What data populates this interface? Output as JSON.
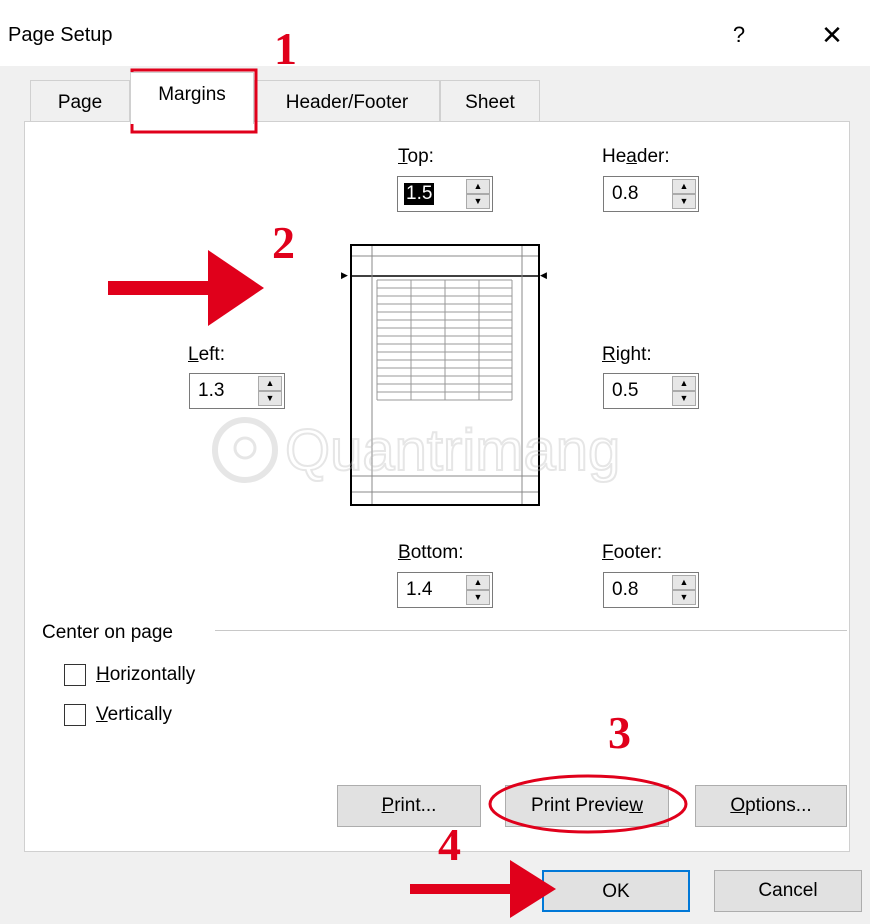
{
  "window": {
    "title": "Page Setup",
    "help_label": "?",
    "close_label": "✕"
  },
  "tabs": [
    {
      "label": "Page"
    },
    {
      "label": "Margins"
    },
    {
      "label": "Header/Footer"
    },
    {
      "label": "Sheet"
    }
  ],
  "margins": {
    "top": {
      "label_u": "T",
      "label_rest": "op:",
      "value": "1.5"
    },
    "header": {
      "label_pre": "He",
      "label_u": "a",
      "label_rest": "der:",
      "value": "0.8"
    },
    "left": {
      "label_u": "L",
      "label_rest": "eft:",
      "value": "1.3"
    },
    "right": {
      "label_u": "R",
      "label_rest": "ight:",
      "value": "0.5"
    },
    "bottom": {
      "label_u": "B",
      "label_rest": "ottom:",
      "value": "1.4"
    },
    "footer": {
      "label_u": "F",
      "label_rest": "ooter:",
      "value": "0.8"
    }
  },
  "center_on_page": {
    "title": "Center on page",
    "horizontally": {
      "label_u": "H",
      "label_rest": "orizontally",
      "checked": false
    },
    "vertically": {
      "label_u": "V",
      "label_rest": "ertically",
      "checked": false
    }
  },
  "buttons": {
    "print": {
      "label_u": "P",
      "label_rest": "rint..."
    },
    "print_preview": {
      "label_pre": "Print Previe",
      "label_u": "w"
    },
    "options": {
      "label_u": "O",
      "label_rest": "ptions..."
    },
    "ok": "OK",
    "cancel": "Cancel"
  },
  "annotations": {
    "step1": "1",
    "step2": "2",
    "step3": "3",
    "step4": "4",
    "color": "#e0001b"
  },
  "watermark": {
    "text": "Quantrimang"
  }
}
